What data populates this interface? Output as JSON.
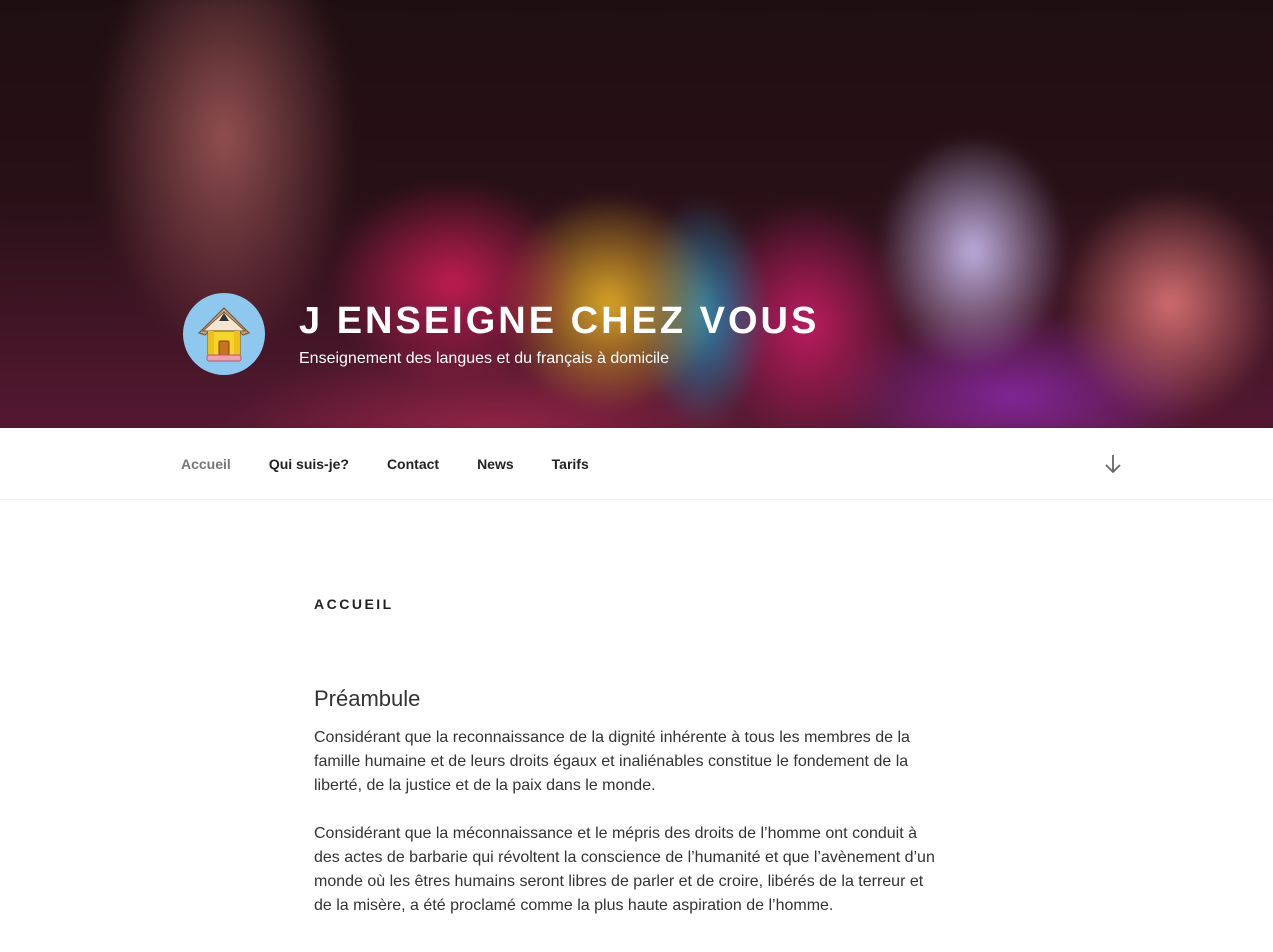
{
  "header": {
    "site_title": "J ENSEIGNE CHEZ VOUS",
    "site_description": "Enseignement des langues et du français à domicile",
    "logo_icon": "pencil-house-icon"
  },
  "nav": {
    "items": [
      {
        "label": "Accueil",
        "current": true
      },
      {
        "label": "Qui suis-je?"
      },
      {
        "label": "Contact"
      },
      {
        "label": "News"
      },
      {
        "label": "Tarifs"
      }
    ],
    "scroll_icon": "arrow-down-icon"
  },
  "main": {
    "page_title": "ACCUEIL",
    "section_title": "Préambule",
    "paragraphs": [
      "Considérant que la reconnaissance de la dignité inhérente à tous les membres de la famille humaine et de leurs droits égaux et inaliénables constitue le fondement de la liberté, de la justice et de la paix dans le monde.",
      "Considérant que la méconnaissance et le mépris des droits de l’homme ont conduit à des actes de barbarie qui révoltent la conscience de l’humanité et que l’avènement d’un monde où les êtres humains seront libres de parler et de croire, libérés de la terreur et de la misère, a été proclamé comme la plus haute aspiration de l’homme."
    ]
  },
  "colors": {
    "nav_current": "#767676",
    "text": "#222222",
    "logo_bg": "#8fc8ef"
  }
}
